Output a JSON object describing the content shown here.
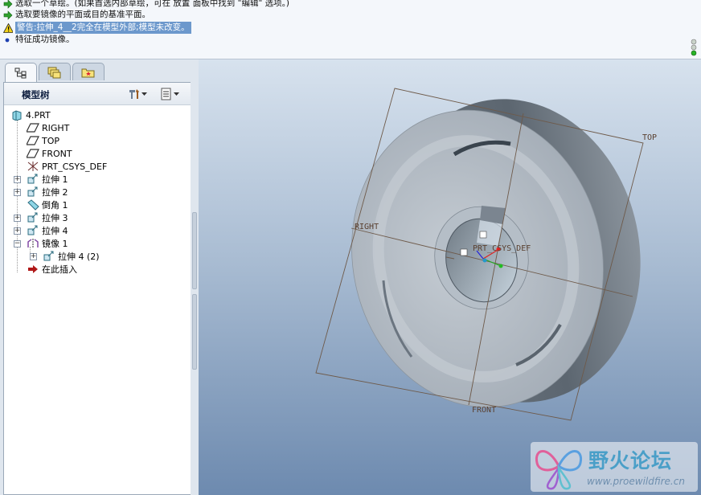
{
  "messages": [
    {
      "type": "prompt",
      "text": "选取一个草绘。(如果首选内部草绘，可在 放置 面板中找到 \"编辑\" 选项。)"
    },
    {
      "type": "prompt",
      "text": "选取要镜像的平面或目的基准平面。"
    },
    {
      "type": "warning",
      "text": "警告:拉伸_4__2完全在模型外部;模型未改变。"
    },
    {
      "type": "info",
      "text": "特征成功镜像。"
    }
  ],
  "model_tree": {
    "title": "模型树",
    "tabs": [
      "model-tree-tab",
      "layer-tab",
      "favorites-tab"
    ],
    "items": [
      {
        "label": "4.PRT",
        "icon": "part-icon",
        "level": 0,
        "expandable": false
      },
      {
        "label": "RIGHT",
        "icon": "datum-plane-icon",
        "level": 1,
        "expandable": false
      },
      {
        "label": "TOP",
        "icon": "datum-plane-icon",
        "level": 1,
        "expandable": false
      },
      {
        "label": "FRONT",
        "icon": "datum-plane-icon",
        "level": 1,
        "expandable": false
      },
      {
        "label": "PRT_CSYS_DEF",
        "icon": "csys-icon",
        "level": 1,
        "expandable": false
      },
      {
        "label": "拉伸 1",
        "icon": "extrude-icon",
        "level": 1,
        "expandable": true
      },
      {
        "label": "拉伸 2",
        "icon": "extrude-icon",
        "level": 1,
        "expandable": true
      },
      {
        "label": "倒角 1",
        "icon": "chamfer-icon",
        "level": 1,
        "expandable": false
      },
      {
        "label": "拉伸 3",
        "icon": "extrude-icon",
        "level": 1,
        "expandable": true
      },
      {
        "label": "拉伸 4",
        "icon": "extrude-icon",
        "level": 1,
        "expandable": true
      },
      {
        "label": "镜像 1",
        "icon": "mirror-icon",
        "level": 1,
        "expandable": true,
        "expanded": true
      },
      {
        "label": "拉伸 4 (2)",
        "icon": "extrude-icon",
        "level": 2,
        "expandable": true
      },
      {
        "label": "在此插入",
        "icon": "insert-here-arrow-icon",
        "level": 1,
        "expandable": false
      }
    ]
  },
  "viewport": {
    "datum_labels": {
      "top": "TOP",
      "right": "RIGHT",
      "front": "FRONT",
      "csys": "PRT_CSYS_DEF"
    }
  },
  "watermark": {
    "title": "野火论坛",
    "url": "www.proewildfire.cn"
  },
  "colors": {
    "warning_highlight": "#6c98cc",
    "part_surface": "#b7c0c9",
    "datum_plane": "#6e5a4a"
  }
}
